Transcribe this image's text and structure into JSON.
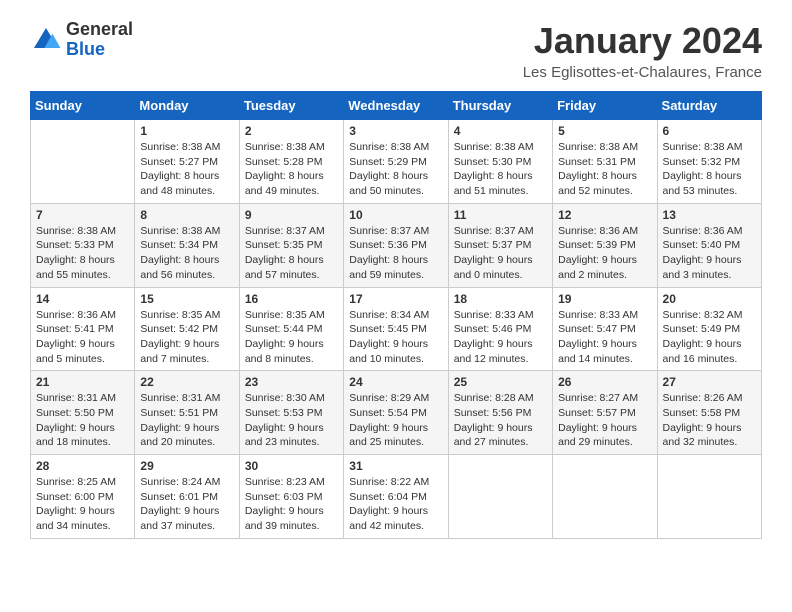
{
  "logo": {
    "general": "General",
    "blue": "Blue"
  },
  "header": {
    "title": "January 2024",
    "subtitle": "Les Eglisottes-et-Chalaures, France"
  },
  "days_of_week": [
    "Sunday",
    "Monday",
    "Tuesday",
    "Wednesday",
    "Thursday",
    "Friday",
    "Saturday"
  ],
  "weeks": [
    {
      "days": [
        {
          "num": "",
          "sunrise": "",
          "sunset": "",
          "daylight": ""
        },
        {
          "num": "1",
          "sunrise": "Sunrise: 8:38 AM",
          "sunset": "Sunset: 5:27 PM",
          "daylight": "Daylight: 8 hours and 48 minutes."
        },
        {
          "num": "2",
          "sunrise": "Sunrise: 8:38 AM",
          "sunset": "Sunset: 5:28 PM",
          "daylight": "Daylight: 8 hours and 49 minutes."
        },
        {
          "num": "3",
          "sunrise": "Sunrise: 8:38 AM",
          "sunset": "Sunset: 5:29 PM",
          "daylight": "Daylight: 8 hours and 50 minutes."
        },
        {
          "num": "4",
          "sunrise": "Sunrise: 8:38 AM",
          "sunset": "Sunset: 5:30 PM",
          "daylight": "Daylight: 8 hours and 51 minutes."
        },
        {
          "num": "5",
          "sunrise": "Sunrise: 8:38 AM",
          "sunset": "Sunset: 5:31 PM",
          "daylight": "Daylight: 8 hours and 52 minutes."
        },
        {
          "num": "6",
          "sunrise": "Sunrise: 8:38 AM",
          "sunset": "Sunset: 5:32 PM",
          "daylight": "Daylight: 8 hours and 53 minutes."
        }
      ]
    },
    {
      "days": [
        {
          "num": "7",
          "sunrise": "Sunrise: 8:38 AM",
          "sunset": "Sunset: 5:33 PM",
          "daylight": "Daylight: 8 hours and 55 minutes."
        },
        {
          "num": "8",
          "sunrise": "Sunrise: 8:38 AM",
          "sunset": "Sunset: 5:34 PM",
          "daylight": "Daylight: 8 hours and 56 minutes."
        },
        {
          "num": "9",
          "sunrise": "Sunrise: 8:37 AM",
          "sunset": "Sunset: 5:35 PM",
          "daylight": "Daylight: 8 hours and 57 minutes."
        },
        {
          "num": "10",
          "sunrise": "Sunrise: 8:37 AM",
          "sunset": "Sunset: 5:36 PM",
          "daylight": "Daylight: 8 hours and 59 minutes."
        },
        {
          "num": "11",
          "sunrise": "Sunrise: 8:37 AM",
          "sunset": "Sunset: 5:37 PM",
          "daylight": "Daylight: 9 hours and 0 minutes."
        },
        {
          "num": "12",
          "sunrise": "Sunrise: 8:36 AM",
          "sunset": "Sunset: 5:39 PM",
          "daylight": "Daylight: 9 hours and 2 minutes."
        },
        {
          "num": "13",
          "sunrise": "Sunrise: 8:36 AM",
          "sunset": "Sunset: 5:40 PM",
          "daylight": "Daylight: 9 hours and 3 minutes."
        }
      ]
    },
    {
      "days": [
        {
          "num": "14",
          "sunrise": "Sunrise: 8:36 AM",
          "sunset": "Sunset: 5:41 PM",
          "daylight": "Daylight: 9 hours and 5 minutes."
        },
        {
          "num": "15",
          "sunrise": "Sunrise: 8:35 AM",
          "sunset": "Sunset: 5:42 PM",
          "daylight": "Daylight: 9 hours and 7 minutes."
        },
        {
          "num": "16",
          "sunrise": "Sunrise: 8:35 AM",
          "sunset": "Sunset: 5:44 PM",
          "daylight": "Daylight: 9 hours and 8 minutes."
        },
        {
          "num": "17",
          "sunrise": "Sunrise: 8:34 AM",
          "sunset": "Sunset: 5:45 PM",
          "daylight": "Daylight: 9 hours and 10 minutes."
        },
        {
          "num": "18",
          "sunrise": "Sunrise: 8:33 AM",
          "sunset": "Sunset: 5:46 PM",
          "daylight": "Daylight: 9 hours and 12 minutes."
        },
        {
          "num": "19",
          "sunrise": "Sunrise: 8:33 AM",
          "sunset": "Sunset: 5:47 PM",
          "daylight": "Daylight: 9 hours and 14 minutes."
        },
        {
          "num": "20",
          "sunrise": "Sunrise: 8:32 AM",
          "sunset": "Sunset: 5:49 PM",
          "daylight": "Daylight: 9 hours and 16 minutes."
        }
      ]
    },
    {
      "days": [
        {
          "num": "21",
          "sunrise": "Sunrise: 8:31 AM",
          "sunset": "Sunset: 5:50 PM",
          "daylight": "Daylight: 9 hours and 18 minutes."
        },
        {
          "num": "22",
          "sunrise": "Sunrise: 8:31 AM",
          "sunset": "Sunset: 5:51 PM",
          "daylight": "Daylight: 9 hours and 20 minutes."
        },
        {
          "num": "23",
          "sunrise": "Sunrise: 8:30 AM",
          "sunset": "Sunset: 5:53 PM",
          "daylight": "Daylight: 9 hours and 23 minutes."
        },
        {
          "num": "24",
          "sunrise": "Sunrise: 8:29 AM",
          "sunset": "Sunset: 5:54 PM",
          "daylight": "Daylight: 9 hours and 25 minutes."
        },
        {
          "num": "25",
          "sunrise": "Sunrise: 8:28 AM",
          "sunset": "Sunset: 5:56 PM",
          "daylight": "Daylight: 9 hours and 27 minutes."
        },
        {
          "num": "26",
          "sunrise": "Sunrise: 8:27 AM",
          "sunset": "Sunset: 5:57 PM",
          "daylight": "Daylight: 9 hours and 29 minutes."
        },
        {
          "num": "27",
          "sunrise": "Sunrise: 8:26 AM",
          "sunset": "Sunset: 5:58 PM",
          "daylight": "Daylight: 9 hours and 32 minutes."
        }
      ]
    },
    {
      "days": [
        {
          "num": "28",
          "sunrise": "Sunrise: 8:25 AM",
          "sunset": "Sunset: 6:00 PM",
          "daylight": "Daylight: 9 hours and 34 minutes."
        },
        {
          "num": "29",
          "sunrise": "Sunrise: 8:24 AM",
          "sunset": "Sunset: 6:01 PM",
          "daylight": "Daylight: 9 hours and 37 minutes."
        },
        {
          "num": "30",
          "sunrise": "Sunrise: 8:23 AM",
          "sunset": "Sunset: 6:03 PM",
          "daylight": "Daylight: 9 hours and 39 minutes."
        },
        {
          "num": "31",
          "sunrise": "Sunrise: 8:22 AM",
          "sunset": "Sunset: 6:04 PM",
          "daylight": "Daylight: 9 hours and 42 minutes."
        },
        {
          "num": "",
          "sunrise": "",
          "sunset": "",
          "daylight": ""
        },
        {
          "num": "",
          "sunrise": "",
          "sunset": "",
          "daylight": ""
        },
        {
          "num": "",
          "sunrise": "",
          "sunset": "",
          "daylight": ""
        }
      ]
    }
  ]
}
